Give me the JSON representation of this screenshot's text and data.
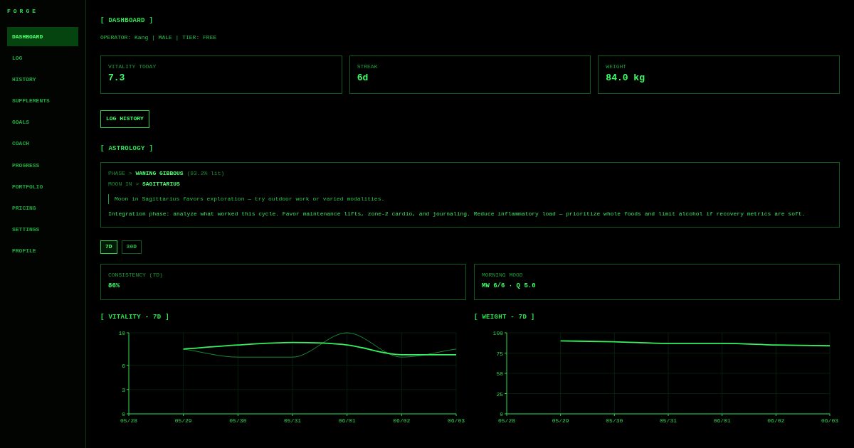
{
  "sidebar": {
    "brand": "FORGE",
    "items": [
      {
        "label": "DASHBOARD",
        "selected": true
      },
      {
        "label": "LOG",
        "selected": false
      },
      {
        "label": "HISTORY",
        "selected": false
      },
      {
        "label": "SUPPLEMENTS",
        "selected": false
      },
      {
        "label": "GOALS",
        "selected": false
      },
      {
        "label": "COACH",
        "selected": false
      },
      {
        "label": "PROGRESS",
        "selected": false
      },
      {
        "label": "PORTFOLIO",
        "selected": false
      },
      {
        "label": "PRICING",
        "selected": false
      },
      {
        "label": "SETTINGS",
        "selected": false
      },
      {
        "label": "PROFILE",
        "selected": false
      }
    ]
  },
  "header": {
    "title": "[ DASHBOARD ]",
    "operator": "OPERATOR: Kang | MALE | TIER: FREE"
  },
  "stats": [
    {
      "label": "VITALITY TODAY",
      "value": "7.3"
    },
    {
      "label": "STREAK",
      "value": "6d"
    },
    {
      "label": "WEIGHT",
      "value": "84.0 kg"
    }
  ],
  "log_history_button": "LOG HISTORY",
  "astrology": {
    "title": "[ ASTROLOGY ]",
    "phase": {
      "label": "PHASE >",
      "value": "WANING GIBBOUS",
      "note": "(93.2% lit)"
    },
    "moon": {
      "label": "MOON IN >",
      "value": "SAGITTARIUS"
    },
    "quote": "Moon in Sagittarius favors exploration — try outdoor work or varied modalities.",
    "summary": "Integration phase: analyze what worked this cycle. Favor maintenance lifts, zone-2 cardio, and journaling. Reduce inflammatory load — prioritize whole foods and limit alcohol if recovery metrics are soft."
  },
  "range_tabs": [
    {
      "label": "7D",
      "selected": true
    },
    {
      "label": "30D",
      "selected": false
    }
  ],
  "metrics": [
    {
      "label": "CONSISTENCY (7D)",
      "value": "86%"
    },
    {
      "label": "MORNING MOOD",
      "value": "MW 6/6 · Q 5.0"
    }
  ],
  "charts": [
    {
      "heading": "[ VITALITY - 7D ]",
      "chart_data": {
        "type": "line",
        "categories": [
          "05/28",
          "05/29",
          "05/30",
          "05/31",
          "06/01",
          "06/02",
          "06/03"
        ],
        "ylim": [
          0,
          10
        ],
        "yticks": [
          0,
          3,
          6,
          10
        ],
        "grid": true,
        "series": [
          {
            "color": "#1d9a3a",
            "values": [
              null,
              8,
              7,
              7,
              10,
              7,
              8
            ]
          },
          {
            "color": "#36f25e",
            "values": [
              null,
              8,
              8.5,
              8.8,
              8.5,
              7.3,
              7.3
            ]
          }
        ]
      }
    },
    {
      "heading": "[ WEIGHT - 7D ]",
      "chart_data": {
        "type": "line",
        "categories": [
          "05/28",
          "05/29",
          "05/30",
          "05/31",
          "06/01",
          "06/02",
          "06/03"
        ],
        "ylim": [
          0,
          100
        ],
        "yticks": [
          0,
          25,
          50,
          75,
          100
        ],
        "grid": true,
        "series": [
          {
            "color": "#36f25e",
            "values": [
              null,
              90,
              89,
              87,
              87,
              85,
              84
            ]
          }
        ]
      }
    }
  ]
}
